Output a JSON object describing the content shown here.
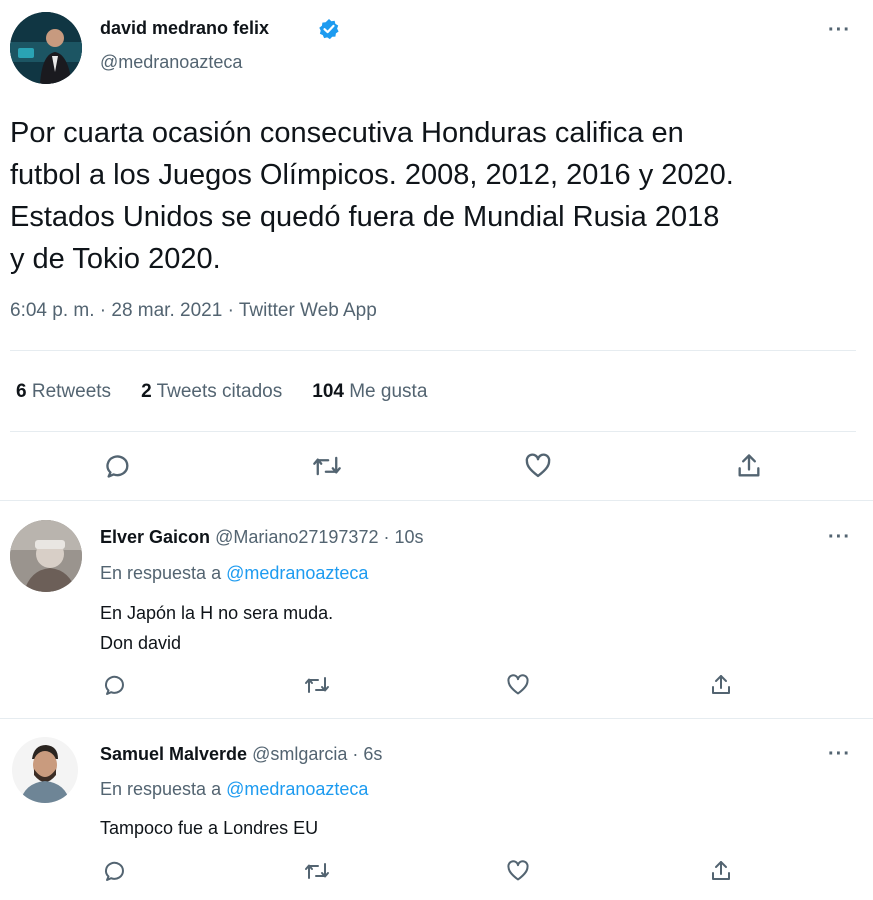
{
  "main_tweet": {
    "author_name": "david medrano felix",
    "author_handle": "@medranoazteca",
    "text_lines": [
      "Por cuarta ocasión consecutiva Honduras califica en",
      "futbol a los Juegos Olímpicos. 2008, 2012, 2016 y 2020.",
      "Estados Unidos se quedó fuera de Mundial Rusia 2018",
      "y de Tokio 2020."
    ],
    "meta": "6:04 p. m. · 28 mar. 2021 · Twitter Web App",
    "stats": [
      {
        "count": "6",
        "label": "Retweets"
      },
      {
        "count": "2",
        "label": "Tweets citados"
      },
      {
        "count": "104",
        "label": "Me gusta"
      }
    ]
  },
  "replies": [
    {
      "author_name": "Elver Gaicon",
      "author_handle": "@Mariano27197372",
      "time": "· 10s",
      "reply_prefix": "En respuesta a",
      "reply_to": "@medranoazteca",
      "text_lines": [
        "En Japón la H no sera muda.",
        "Don david"
      ]
    },
    {
      "author_name": "Samuel Malverde",
      "author_handle": "@smlgarcia",
      "time": "· 6s",
      "reply_prefix": "En respuesta a",
      "reply_to": "@medranoazteca",
      "text_lines": [
        "Tampoco fue a Londres EU"
      ]
    }
  ],
  "more_glyph": "···",
  "colors": {
    "verified": "#1d9bf0",
    "link": "#1d9bf0",
    "muted": "#536471",
    "divider": "#e6ecf0"
  },
  "icons": [
    "reply-icon",
    "retweet-icon",
    "like-icon",
    "share-icon",
    "verified-badge-icon",
    "more-icon"
  ]
}
